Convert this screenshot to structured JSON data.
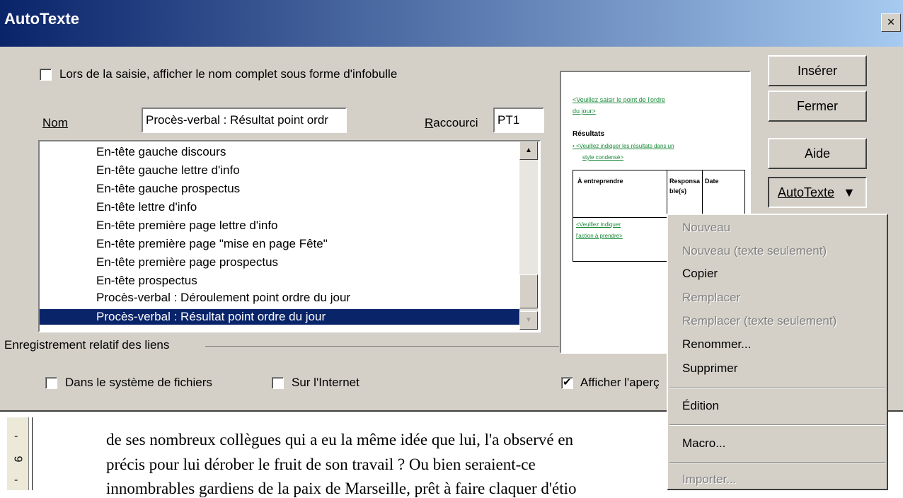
{
  "window": {
    "title": "AutoTexte",
    "close_glyph": "×"
  },
  "tooltip_option": {
    "label": "Lors de la saisie, afficher le nom complet sous forme d'infobulle",
    "checked": false
  },
  "name_field": {
    "label": "Nom",
    "value": "Procès-verbal : Résultat point ordr"
  },
  "shortcut_field": {
    "label": "Raccourci",
    "value": "PT1"
  },
  "list": {
    "items": [
      "En-tête gauche discours",
      "En-tête gauche lettre d'info",
      "En-tête gauche prospectus",
      "En-tête lettre d'info",
      "En-tête première page lettre d'info",
      "En-tête première page \"mise en page Fête\"",
      "En-tête première page prospectus",
      "En-tête prospectus",
      "Procès-verbal : Déroulement point ordre du jour",
      "Procès-verbal : Résultat point ordre du jour"
    ],
    "selected_index": 9
  },
  "links_group": {
    "label": "Enregistrement relatif des liens",
    "filesystem": {
      "label": "Dans le système de fichiers",
      "checked": false
    },
    "internet": {
      "label": "Sur l'Internet",
      "checked": false
    }
  },
  "preview_option": {
    "label": "Afficher l'aperç",
    "checked": true
  },
  "buttons": {
    "insert": "Insérer",
    "close": "Fermer",
    "help": "Aide",
    "autotext": "AutoTexte"
  },
  "preview": {
    "line1": "<Veuillez saisir le point de l'ordre",
    "line2": "du jour>",
    "heading": "Résultats",
    "bullet1": "• <Veuillez indiquer les résultats dans un",
    "bullet1b": "style condensé>",
    "col1": "À entreprendre",
    "col2": "Responsa",
    "col2b": "ble(s)",
    "col3": "Date",
    "cell1": "<Veuillez indiquer",
    "cell1b": "l'action à prendre>"
  },
  "menu": {
    "items": [
      {
        "label": "Nouveau",
        "enabled": false
      },
      {
        "label": "Nouveau (texte seulement)",
        "enabled": false
      },
      {
        "label": "Copier",
        "enabled": true
      },
      {
        "label": "Remplacer",
        "enabled": false
      },
      {
        "label": "Remplacer (texte seulement)",
        "enabled": false
      },
      {
        "label": "Renommer...",
        "enabled": true
      },
      {
        "label": "Supprimer",
        "enabled": true
      },
      {
        "label": "Édition",
        "enabled": true
      },
      {
        "label": "Macro...",
        "enabled": true
      },
      {
        "label": "Importer...",
        "enabled": false
      }
    ]
  },
  "document": {
    "lines": [
      "de ses nombreux collègues qui a eu la même idée que lui, l'a observé en",
      "précis pour  lui dérober le fruit de son travail ? Ou bien seraient-ce",
      "innombrables gardiens de la paix de Marseille, prêt à faire claquer d'étio"
    ],
    "ruler_marks": [
      "-",
      "9",
      "-"
    ]
  }
}
